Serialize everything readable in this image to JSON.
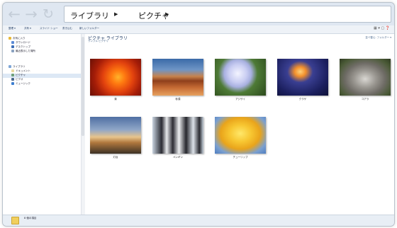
{
  "address_bar": {
    "crumbs": [
      "ライブラリ",
      "ピクチャ"
    ]
  },
  "toolbar": {
    "items": [
      "整理 ▾",
      "共有 ▾",
      "スライド ショー",
      "書き込む",
      "新しいフォルダー"
    ],
    "view_icons": "▦ ▾  ▢  ❓"
  },
  "nav": {
    "favorites": "お気に入り",
    "downloads": "ダウンロード",
    "desktop": "デスクトップ",
    "recent": "最近表示した場所",
    "libraries": "ライブラリ",
    "documents": "ドキュメント",
    "pictures": "ピクチャ",
    "videos": "ビデオ",
    "music": "ミュージック"
  },
  "library": {
    "title": "ピクチャ ライブラリ",
    "subtitle": "サンプル ピクチャ",
    "arrange": "並べ替え:  フォルダー ▾"
  },
  "pictures": [
    {
      "caption": "菊",
      "icon": "chrysanthemum-image"
    },
    {
      "caption": "砂漠",
      "icon": "desert-image"
    },
    {
      "caption": "アジサイ",
      "icon": "hydrangeas-image"
    },
    {
      "caption": "クラゲ",
      "icon": "jellyfish-image"
    },
    {
      "caption": "コアラ",
      "icon": "koala-image"
    },
    {
      "caption": "灯台",
      "icon": "lighthouse-image"
    },
    {
      "caption": "ペンギン",
      "icon": "penguins-image"
    },
    {
      "caption": "チューリップ",
      "icon": "tulips-image"
    }
  ],
  "status": {
    "text": "8 個の項目"
  }
}
